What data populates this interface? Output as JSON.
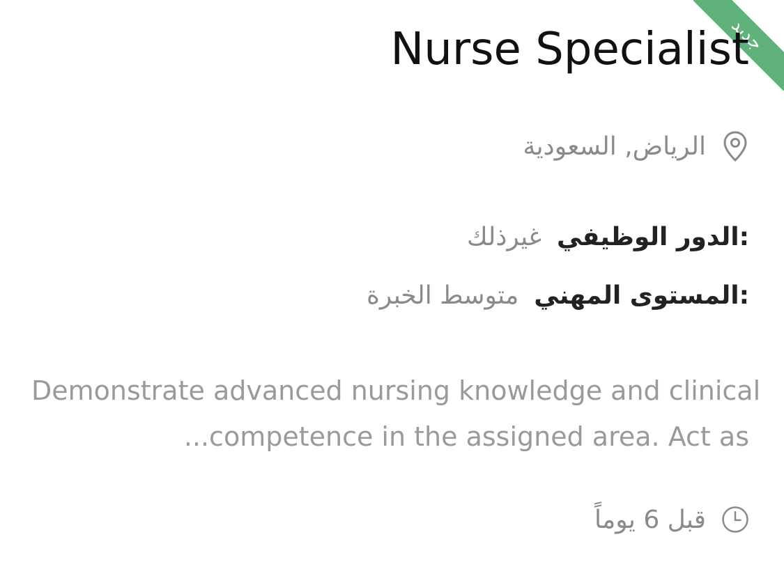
{
  "job": {
    "badge": "جديد",
    "title": "Nurse Specialist",
    "location": "الرياض, السعودية",
    "role_label": "الدور الوظيفي:",
    "role_value": "غيرذلك",
    "level_label": "المستوى المهني:",
    "level_value": "متوسط الخبرة",
    "description_line1": "Demonstrate advanced nursing knowledge and clinical",
    "description_line2": "...competence in the assigned area. Act as",
    "posted": "قبل 6 يوماً"
  },
  "icons": {
    "location": "map-pin-icon",
    "time": "clock-icon"
  },
  "colors": {
    "ribbon": "#5fb27a",
    "title": "#111111",
    "muted": "#8a8a8a",
    "label": "#222222"
  }
}
